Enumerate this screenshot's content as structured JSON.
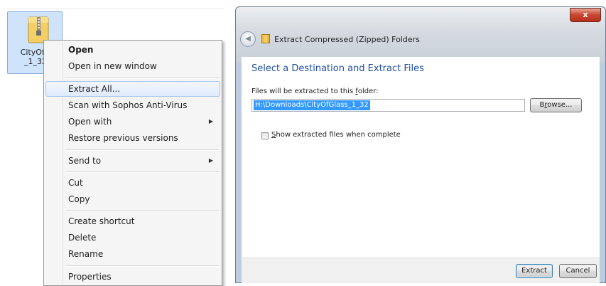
{
  "file": {
    "name_line1": "CityOfG",
    "name_line2": "_1_32",
    "icon": "zip-folder-icon"
  },
  "context_menu": {
    "open": "Open",
    "open_new_window": "Open in new window",
    "extract_all": "Extract All...",
    "scan_sophos": "Scan with Sophos Anti-Virus",
    "open_with": "Open with",
    "restore_previous": "Restore previous versions",
    "send_to": "Send to",
    "cut": "Cut",
    "copy": "Copy",
    "create_shortcut": "Create shortcut",
    "delete": "Delete",
    "rename": "Rename",
    "properties": "Properties",
    "submenu_arrow": "▶"
  },
  "dialog": {
    "title": "Extract Compressed (Zipped) Folders",
    "close_label": "x",
    "back_glyph": "◀",
    "heading": "Select a Destination and Extract Files",
    "folder_label_pre": "Files will be extracted to this ",
    "folder_label_underlined": "f",
    "folder_label_post": "older:",
    "path_value": "H:\\Downloads\\CityOfGlass_1_32",
    "browse_pre": "B",
    "browse_underlined": "r",
    "browse_post": "owse...",
    "show_files_underlined": "S",
    "show_files_post": "how extracted files when complete",
    "show_files_checked": false,
    "extract_label": "Extract",
    "cancel_label": "Cancel"
  },
  "colors": {
    "heading_blue": "#1f50a0",
    "selection_blue": "#3399ff",
    "close_red": "#c8452f"
  }
}
